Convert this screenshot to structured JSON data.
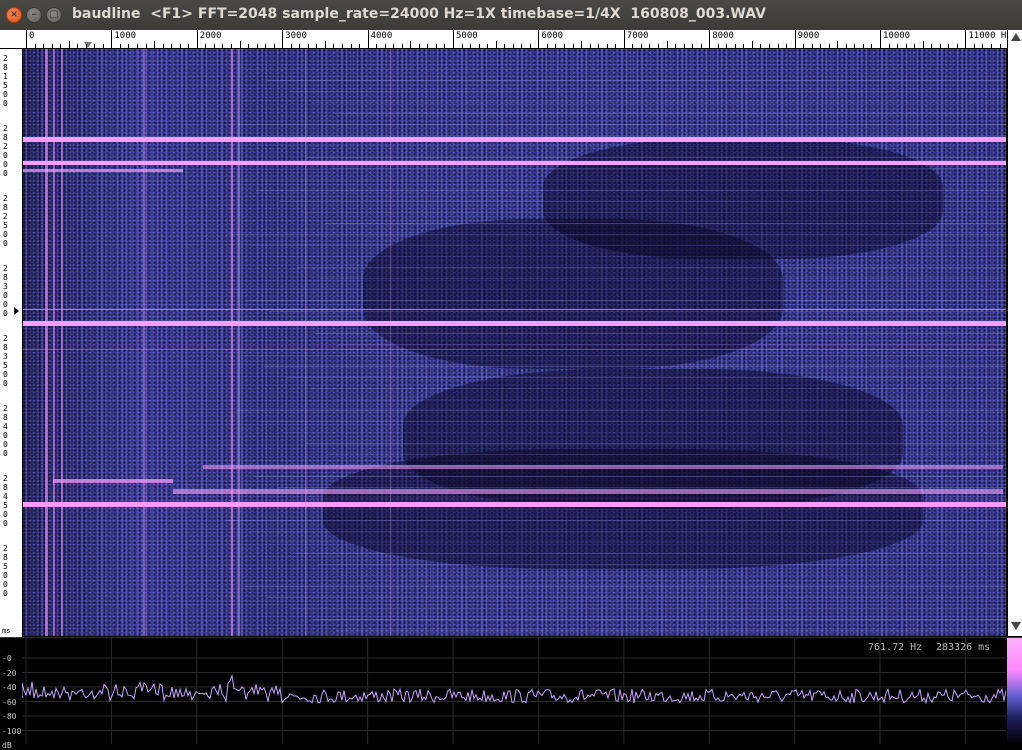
{
  "window": {
    "title": "baudline  <F1> FFT=2048 sample_rate=24000 Hz=1X timebase=1/4X  160808_003.WAV",
    "close_glyph": "×",
    "min_glyph": "–",
    "max_glyph": "▢"
  },
  "freq_ruler": {
    "labels": [
      "0",
      "1000",
      "2000",
      "3000",
      "4000",
      "5000",
      "6000",
      "7000",
      "8000",
      "9000",
      "10000",
      "11000 Hz"
    ]
  },
  "time_ruler": {
    "groups": [
      [
        "2",
        "8",
        "1",
        "5",
        "0",
        "0"
      ],
      [
        "2",
        "8",
        "2",
        "0",
        "0",
        "0"
      ],
      [
        "2",
        "8",
        "2",
        "5",
        "0",
        "0"
      ],
      [
        "2",
        "8",
        "3",
        "0",
        "0",
        "0"
      ],
      [
        "2",
        "8",
        "3",
        "5",
        "0",
        "0"
      ],
      [
        "2",
        "8",
        "4",
        "0",
        "0",
        "0"
      ],
      [
        "2",
        "8",
        "4",
        "5",
        "0",
        "0"
      ],
      [
        "2",
        "8",
        "5",
        "0",
        "0",
        "0"
      ]
    ],
    "unit": "ms"
  },
  "spectrum": {
    "y_labels": [
      "-0",
      "-20",
      "-40",
      "-60",
      "-80",
      "-100",
      "dB"
    ],
    "freq_readout": "761.72 Hz",
    "time_readout": "283326 ms"
  },
  "colors": {
    "signal_pink": "#ff9cff",
    "spectro_blue": "#3a3a96",
    "trace": "#c6a6ff"
  }
}
